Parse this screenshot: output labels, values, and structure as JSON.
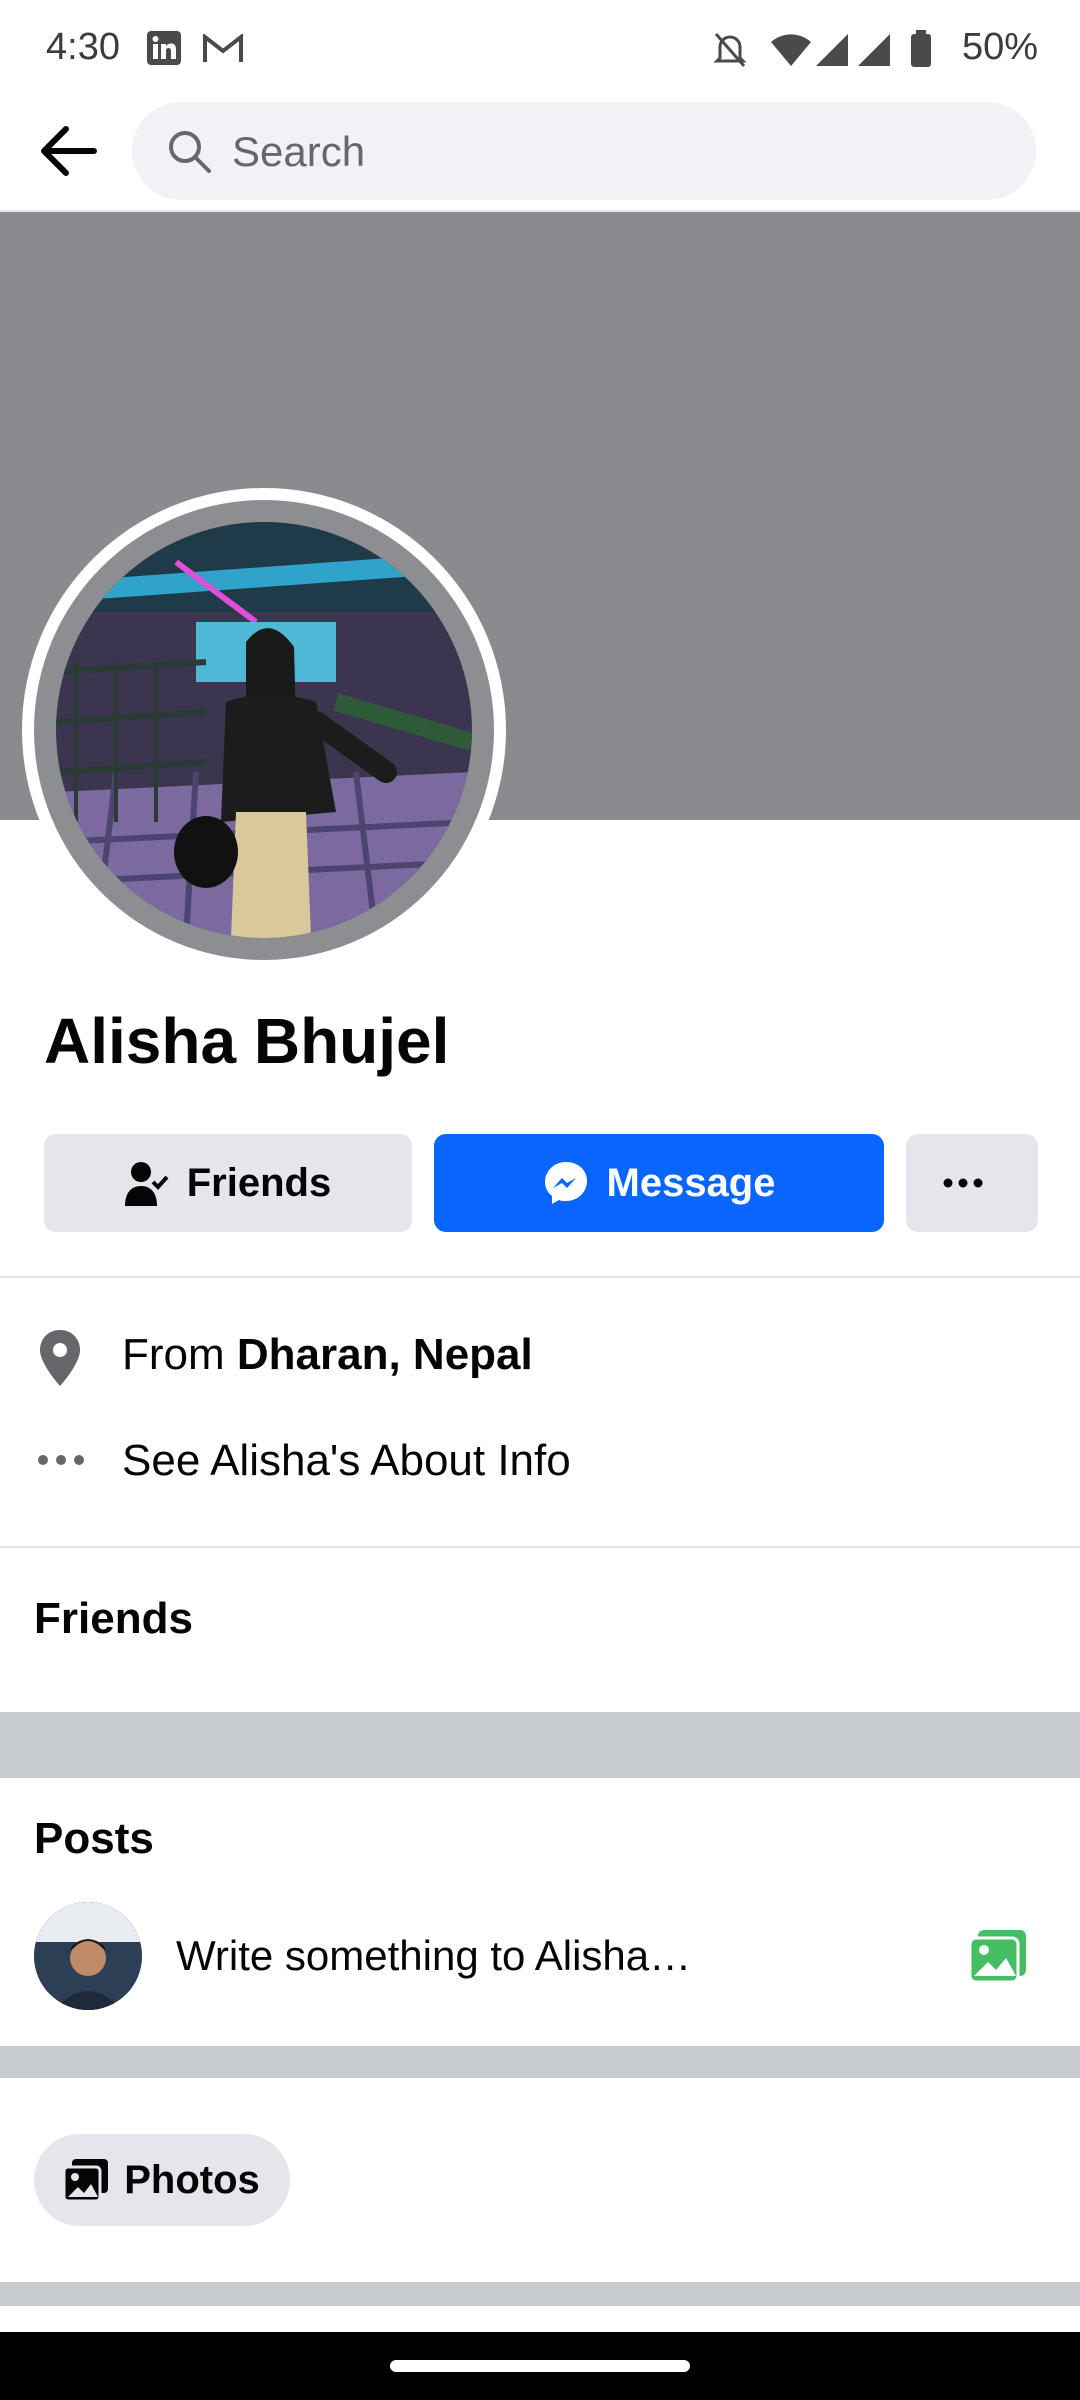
{
  "status_bar": {
    "time": "4:30",
    "battery": "50%",
    "icons": [
      "linkedin-icon",
      "gmail-icon",
      "mute-icon",
      "wifi-icon",
      "signal-icon",
      "signal-icon",
      "battery-icon"
    ]
  },
  "app_bar": {
    "back_icon": "back-arrow-icon",
    "search_placeholder": "Search"
  },
  "profile": {
    "name": "Alisha Bhujel"
  },
  "actions": {
    "friends_label": "Friends",
    "message_label": "Message",
    "more_icon": "more-dots-icon"
  },
  "about": {
    "from_prefix": "From",
    "from_place": "Dharan, Nepal",
    "see_about": "See Alisha's About Info"
  },
  "sections": {
    "friends_heading": "Friends",
    "posts_heading": "Posts",
    "composer_placeholder": "Write something to Alisha…",
    "photos_chip": "Photos"
  },
  "colors": {
    "brand_blue": "#0866ff",
    "cover_gray": "#898b8e",
    "photo_green": "#45bd62"
  }
}
